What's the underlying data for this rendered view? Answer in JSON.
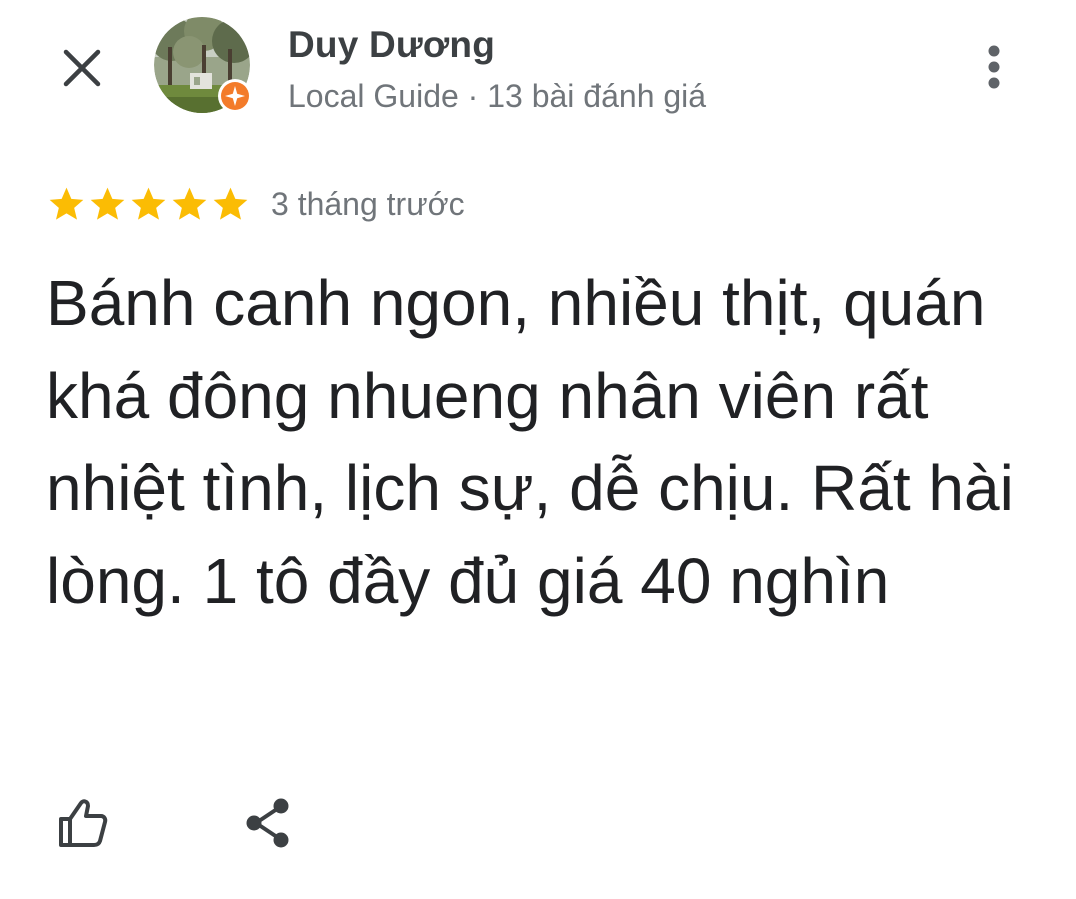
{
  "reviewer": {
    "name": "Duy Dương",
    "meta": "Local Guide · 13 bài đánh giá",
    "avatar_alt": "avatar"
  },
  "review": {
    "rating": 5,
    "rating_max": 5,
    "time": "3 tháng trước",
    "text": "Bánh canh ngon, nhiều thịt, quán khá đông nhueng nhân viên rất nhiệt tình, lịch sự, dễ chịu. Rất hài lòng. 1 tô đầy đủ giá 40 nghìn"
  },
  "icons": {
    "close": "close-icon",
    "more": "more-vert-icon",
    "like": "thumb-up-icon",
    "share": "share-icon",
    "badge": "local-guide-badge-icon",
    "star": "star-icon"
  },
  "colors": {
    "star": "#fbbc04",
    "badge": "#f37b2a",
    "text_primary": "#202124",
    "text_secondary": "#70757a",
    "icon": "#3c4043"
  }
}
